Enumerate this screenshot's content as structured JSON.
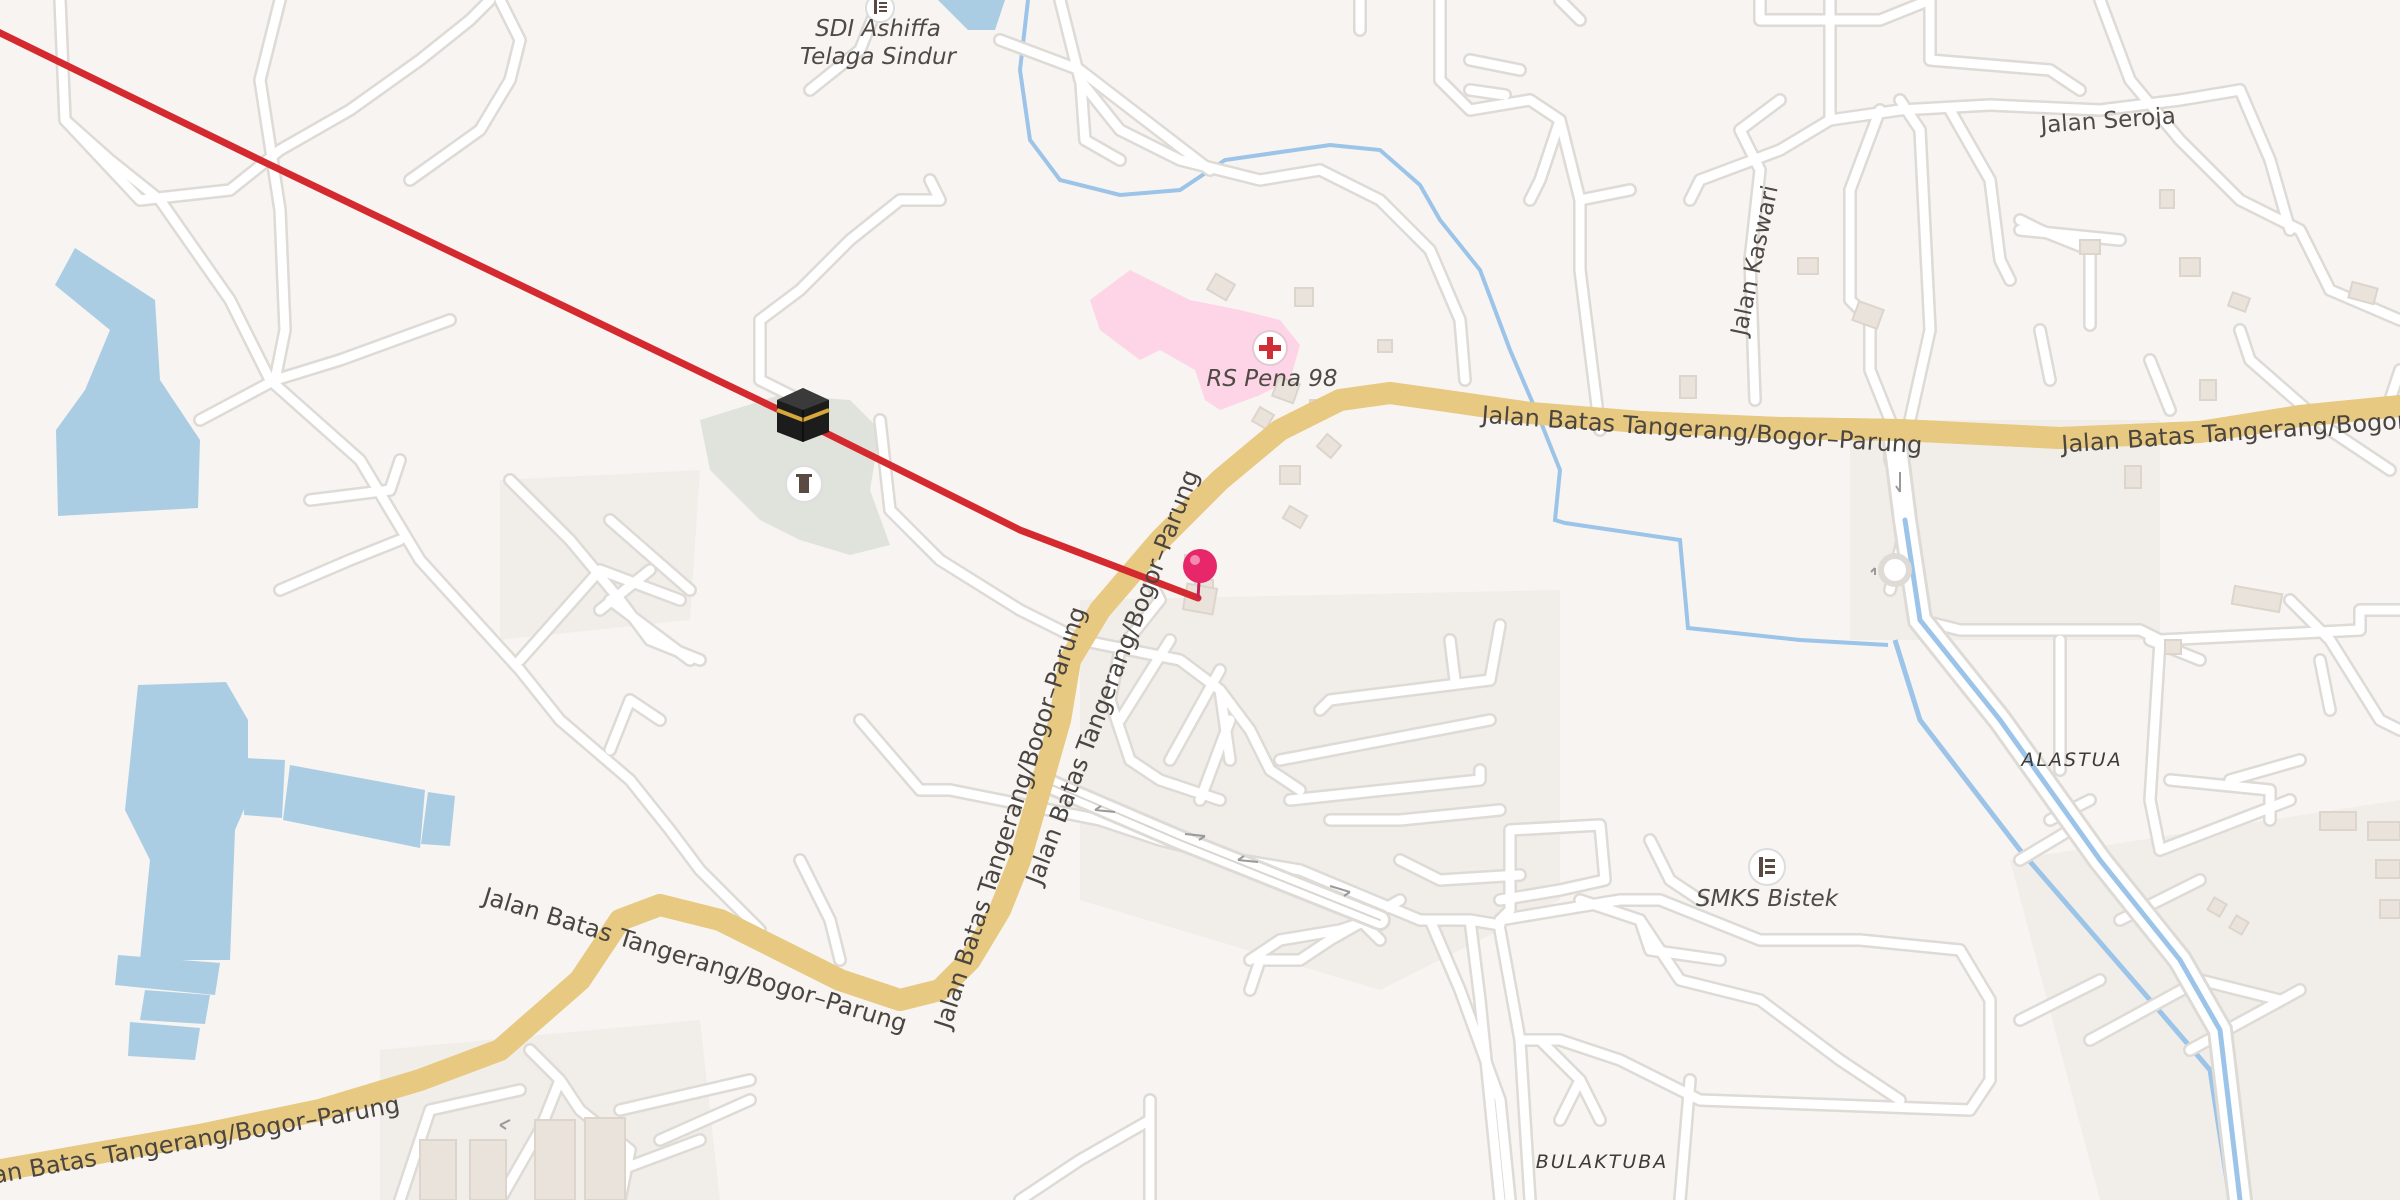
{
  "map": {
    "colors": {
      "background": "#f7f4f1",
      "water": "#abcde4",
      "river": "#9cc4e8",
      "minor_road": "#ffffff",
      "minor_road_casing": "#dedad5",
      "main_road_fill": "#fbe3a6",
      "main_road_casing": "#e7c981",
      "route_line": "#d42a2f",
      "hospital_area": "#fdd5e6",
      "cemetery_area": "#dfe3dc",
      "pin": "#e8276a"
    },
    "labels": {
      "sdi_line1": "SDI Ashiffa",
      "sdi_line2": "Telaga Sindur",
      "jalan_seroja": "Jalan Seroja",
      "jalan_kaswari": "Jalan Kaswari",
      "rs_pena": "RS Pena 98",
      "main_road_east_1": "Jalan Batas Tangerang/Bogor–Parung",
      "main_road_east_2": "Jalan Batas Tangerang/Bogor–",
      "main_road_mid_upper": "Jalan Batas Tangerang/Bogor–Parung",
      "main_road_mid_lower": "Jalan Batas Tangerang/Bogor–Parung",
      "main_road_sw": "Jalan Batas Tangerang/Bogor–Parung",
      "main_road_west": "an Batas Tangerang/Bogor–Parung",
      "alastua": "ALASTUA",
      "smks_bistek": "SMKS Bistek",
      "bulaktuba": "BULAKTUBA"
    },
    "icons": {
      "school_icon": "school-icon",
      "hospital_icon": "hospital-cross-icon",
      "mosque_icon": "kaaba-icon",
      "cemetery_icon": "cemetery-icon",
      "pin_icon": "location-pin-icon"
    }
  }
}
